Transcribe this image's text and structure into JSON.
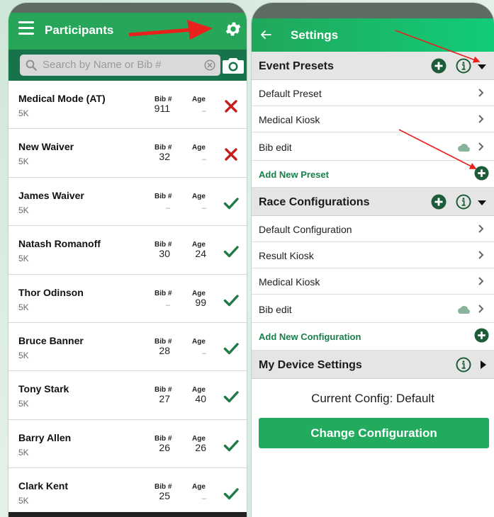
{
  "participants_screen": {
    "title": "Participants",
    "search": {
      "placeholder": "Search by Name or Bib #"
    },
    "bib_label": "Bib #",
    "age_label": "Age",
    "rows": [
      {
        "name": "Medical Mode (AT)",
        "race": "5K",
        "bib": "911",
        "age": "–",
        "status": "rejected"
      },
      {
        "name": "New Waiver",
        "race": "5K",
        "bib": "32",
        "age": "–",
        "status": "rejected"
      },
      {
        "name": "James Waiver",
        "race": "5K",
        "bib": "–",
        "age": "–",
        "status": "accepted"
      },
      {
        "name": "Natash Romanoff",
        "race": "5K",
        "bib": "30",
        "age": "24",
        "status": "accepted"
      },
      {
        "name": "Thor Odinson",
        "race": "5K",
        "bib": "–",
        "age": "99",
        "status": "accepted"
      },
      {
        "name": "Bruce Banner",
        "race": "5K",
        "bib": "28",
        "age": "–",
        "status": "accepted"
      },
      {
        "name": "Tony Stark",
        "race": "5K",
        "bib": "27",
        "age": "40",
        "status": "accepted"
      },
      {
        "name": "Barry Allen",
        "race": "5K",
        "bib": "26",
        "age": "26",
        "status": "accepted"
      },
      {
        "name": "Clark Kent",
        "race": "5K",
        "bib": "25",
        "age": "–",
        "status": "accepted"
      }
    ]
  },
  "settings_screen": {
    "title": "Settings",
    "event_presets": {
      "title": "Event Presets",
      "items": [
        "Default Preset",
        "Medical Kiosk",
        "Bib edit"
      ],
      "add_label": "Add New Preset"
    },
    "race_configurations": {
      "title": "Race Configurations",
      "items": [
        "Default Configuration",
        "Result Kiosk",
        "Medical Kiosk",
        "Bib edit"
      ],
      "add_label": "Add New Configuration"
    },
    "device_settings": {
      "title": "My Device Settings"
    },
    "current_config": "Current Config: Default",
    "change_button": "Change Configuration"
  },
  "colors": {
    "brand_green": "#27a65a",
    "dark_green": "#16734a",
    "reject_red": "#c41e1e",
    "accept_green": "#1f7a45",
    "annotation_red": "#e8211d"
  }
}
